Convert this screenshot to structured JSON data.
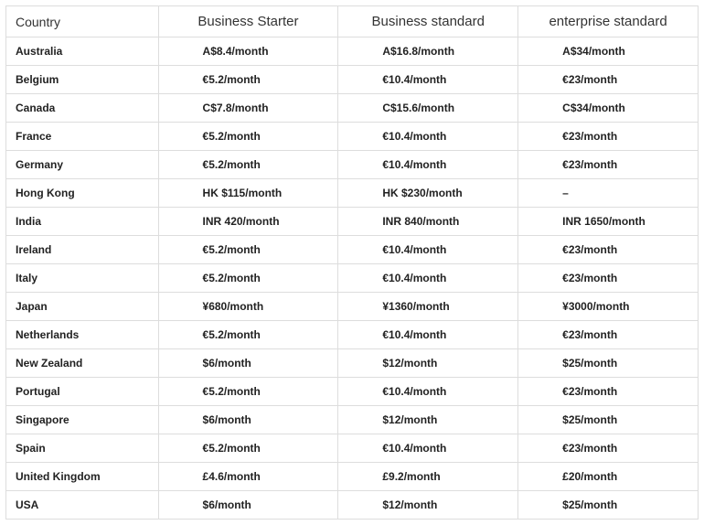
{
  "table": {
    "headers": {
      "country": "Country",
      "plan1": "Business Starter",
      "plan2": "Business standard",
      "plan3": "enterprise standard"
    },
    "rows": [
      {
        "country": "Australia",
        "starter": "A$8.4/month",
        "standard": "A$16.8/month",
        "enterprise": "A$34/month"
      },
      {
        "country": "Belgium",
        "starter": "€5.2/month",
        "standard": "€10.4/month",
        "enterprise": "€23/month"
      },
      {
        "country": "Canada",
        "starter": "C$7.8/month",
        "standard": "C$15.6/month",
        "enterprise": "C$34/month"
      },
      {
        "country": " France",
        "starter": "€5.2/month",
        "standard": "€10.4/month",
        "enterprise": "€23/month"
      },
      {
        "country": "Germany",
        "starter": "€5.2/month",
        "standard": "€10.4/month",
        "enterprise": "€23/month"
      },
      {
        "country": "Hong Kong",
        "starter": "HK $115/month",
        "standard": "HK $230/month",
        "enterprise": "–"
      },
      {
        "country": "India",
        "starter": "INR 420/month",
        "standard": "INR 840/month",
        "enterprise": "INR 1650/month"
      },
      {
        "country": "Ireland",
        "starter": "€5.2/month",
        "standard": "€10.4/month",
        "enterprise": "€23/month"
      },
      {
        "country": "Italy",
        "starter": "€5.2/month",
        "standard": "€10.4/month",
        "enterprise": "€23/month"
      },
      {
        "country": "Japan",
        "starter": "¥680/month",
        "standard": "¥1360/month",
        "enterprise": "¥3000/month"
      },
      {
        "country": "Netherlands",
        "starter": "€5.2/month",
        "standard": "€10.4/month",
        "enterprise": "€23/month"
      },
      {
        "country": "New Zealand",
        "starter": "$6/month",
        "standard": "$12/month",
        "enterprise": "$25/month"
      },
      {
        "country": "Portugal",
        "starter": "€5.2/month",
        "standard": "€10.4/month",
        "enterprise": "€23/month"
      },
      {
        "country": "Singapore",
        "starter": "$6/month",
        "standard": "$12/month",
        "enterprise": "$25/month"
      },
      {
        "country": "Spain",
        "starter": "€5.2/month",
        "standard": "€10.4/month",
        "enterprise": "€23/month"
      },
      {
        "country": "United Kingdom",
        "starter": "£4.6/month",
        "standard": "£9.2/month",
        "enterprise": "£20/month"
      },
      {
        "country": "USA",
        "starter": "$6/month",
        "standard": "$12/month",
        "enterprise": "$25/month"
      }
    ]
  },
  "chart_data": {
    "type": "table",
    "title": "",
    "columns": [
      "Country",
      "Business Starter",
      "Business standard",
      "enterprise standard"
    ],
    "rows": [
      [
        "Australia",
        "A$8.4/month",
        "A$16.8/month",
        "A$34/month"
      ],
      [
        "Belgium",
        "€5.2/month",
        "€10.4/month",
        "€23/month"
      ],
      [
        "Canada",
        "C$7.8/month",
        "C$15.6/month",
        "C$34/month"
      ],
      [
        "France",
        "€5.2/month",
        "€10.4/month",
        "€23/month"
      ],
      [
        "Germany",
        "€5.2/month",
        "€10.4/month",
        "€23/month"
      ],
      [
        "Hong Kong",
        "HK $115/month",
        "HK $230/month",
        "–"
      ],
      [
        "India",
        "INR 420/month",
        "INR 840/month",
        "INR 1650/month"
      ],
      [
        "Ireland",
        "€5.2/month",
        "€10.4/month",
        "€23/month"
      ],
      [
        "Italy",
        "€5.2/month",
        "€10.4/month",
        "€23/month"
      ],
      [
        "Japan",
        "¥680/month",
        "¥1360/month",
        "¥3000/month"
      ],
      [
        "Netherlands",
        "€5.2/month",
        "€10.4/month",
        "€23/month"
      ],
      [
        "New Zealand",
        "$6/month",
        "$12/month",
        "$25/month"
      ],
      [
        "Portugal",
        "€5.2/month",
        "€10.4/month",
        "€23/month"
      ],
      [
        "Singapore",
        "$6/month",
        "$12/month",
        "$25/month"
      ],
      [
        "Spain",
        "€5.2/month",
        "€10.4/month",
        "€23/month"
      ],
      [
        "United Kingdom",
        "£4.6/month",
        "£9.2/month",
        "£20/month"
      ],
      [
        "USA",
        "$6/month",
        "$12/month",
        "$25/month"
      ]
    ]
  }
}
